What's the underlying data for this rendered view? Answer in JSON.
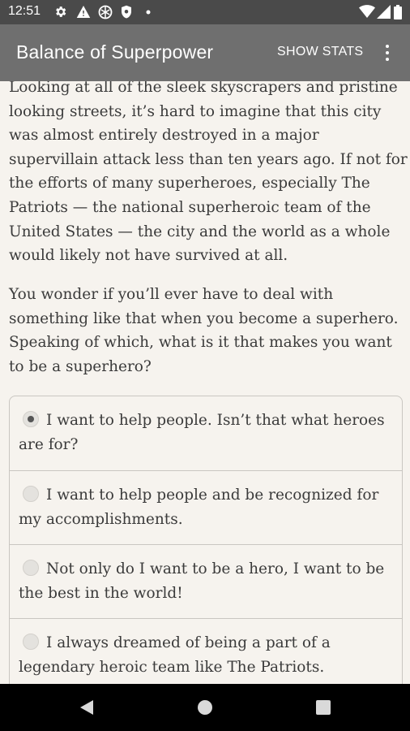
{
  "status_bar": {
    "time": "12:51",
    "left_icons": [
      "settings-icon",
      "warning-icon",
      "vpn-icon",
      "shield-icon",
      "dot-icon"
    ],
    "right_icons": [
      "wifi-icon",
      "signal-icon",
      "battery-icon"
    ]
  },
  "app_bar": {
    "title": "Balance of Superpower",
    "show_stats_label": "SHOW STATS",
    "overflow_icon": "more-vert-icon"
  },
  "story": {
    "paragraph1": "Looking at all of the sleek skyscrapers and pristine looking streets, it’s hard to imagine that this city was almost entirely destroyed in a major supervillain attack less than ten years ago. If not for the efforts of many superheroes, especially The Patriots — the national superheroic team of the United States — the city and the world as a whole would likely not have survived at all.",
    "paragraph2": "You wonder if you’ll ever have to deal with something like that when you become a superhero. Speaking of which, what is it that makes you want to be a superhero?"
  },
  "choices": [
    {
      "label": "I want to help people. Isn’t that what heroes are for?",
      "selected": true
    },
    {
      "label": "I want to help people and be recognized for my accomplishments.",
      "selected": false
    },
    {
      "label": "Not only do I want to be a hero, I want to be the best in the world!",
      "selected": false
    },
    {
      "label": "I always dreamed of being a part of a legendary heroic team like The Patriots.",
      "selected": false
    }
  ],
  "nav_bar": {
    "back_icon": "back-triangle-icon",
    "home_icon": "home-circle-icon",
    "recents_icon": "recents-square-icon"
  },
  "colors": {
    "status_bar": "#4a4a4a",
    "app_bar": "#6f6f6f",
    "background": "#f6f3ee",
    "text": "#3b3b3b",
    "nav_bar": "#000000"
  }
}
